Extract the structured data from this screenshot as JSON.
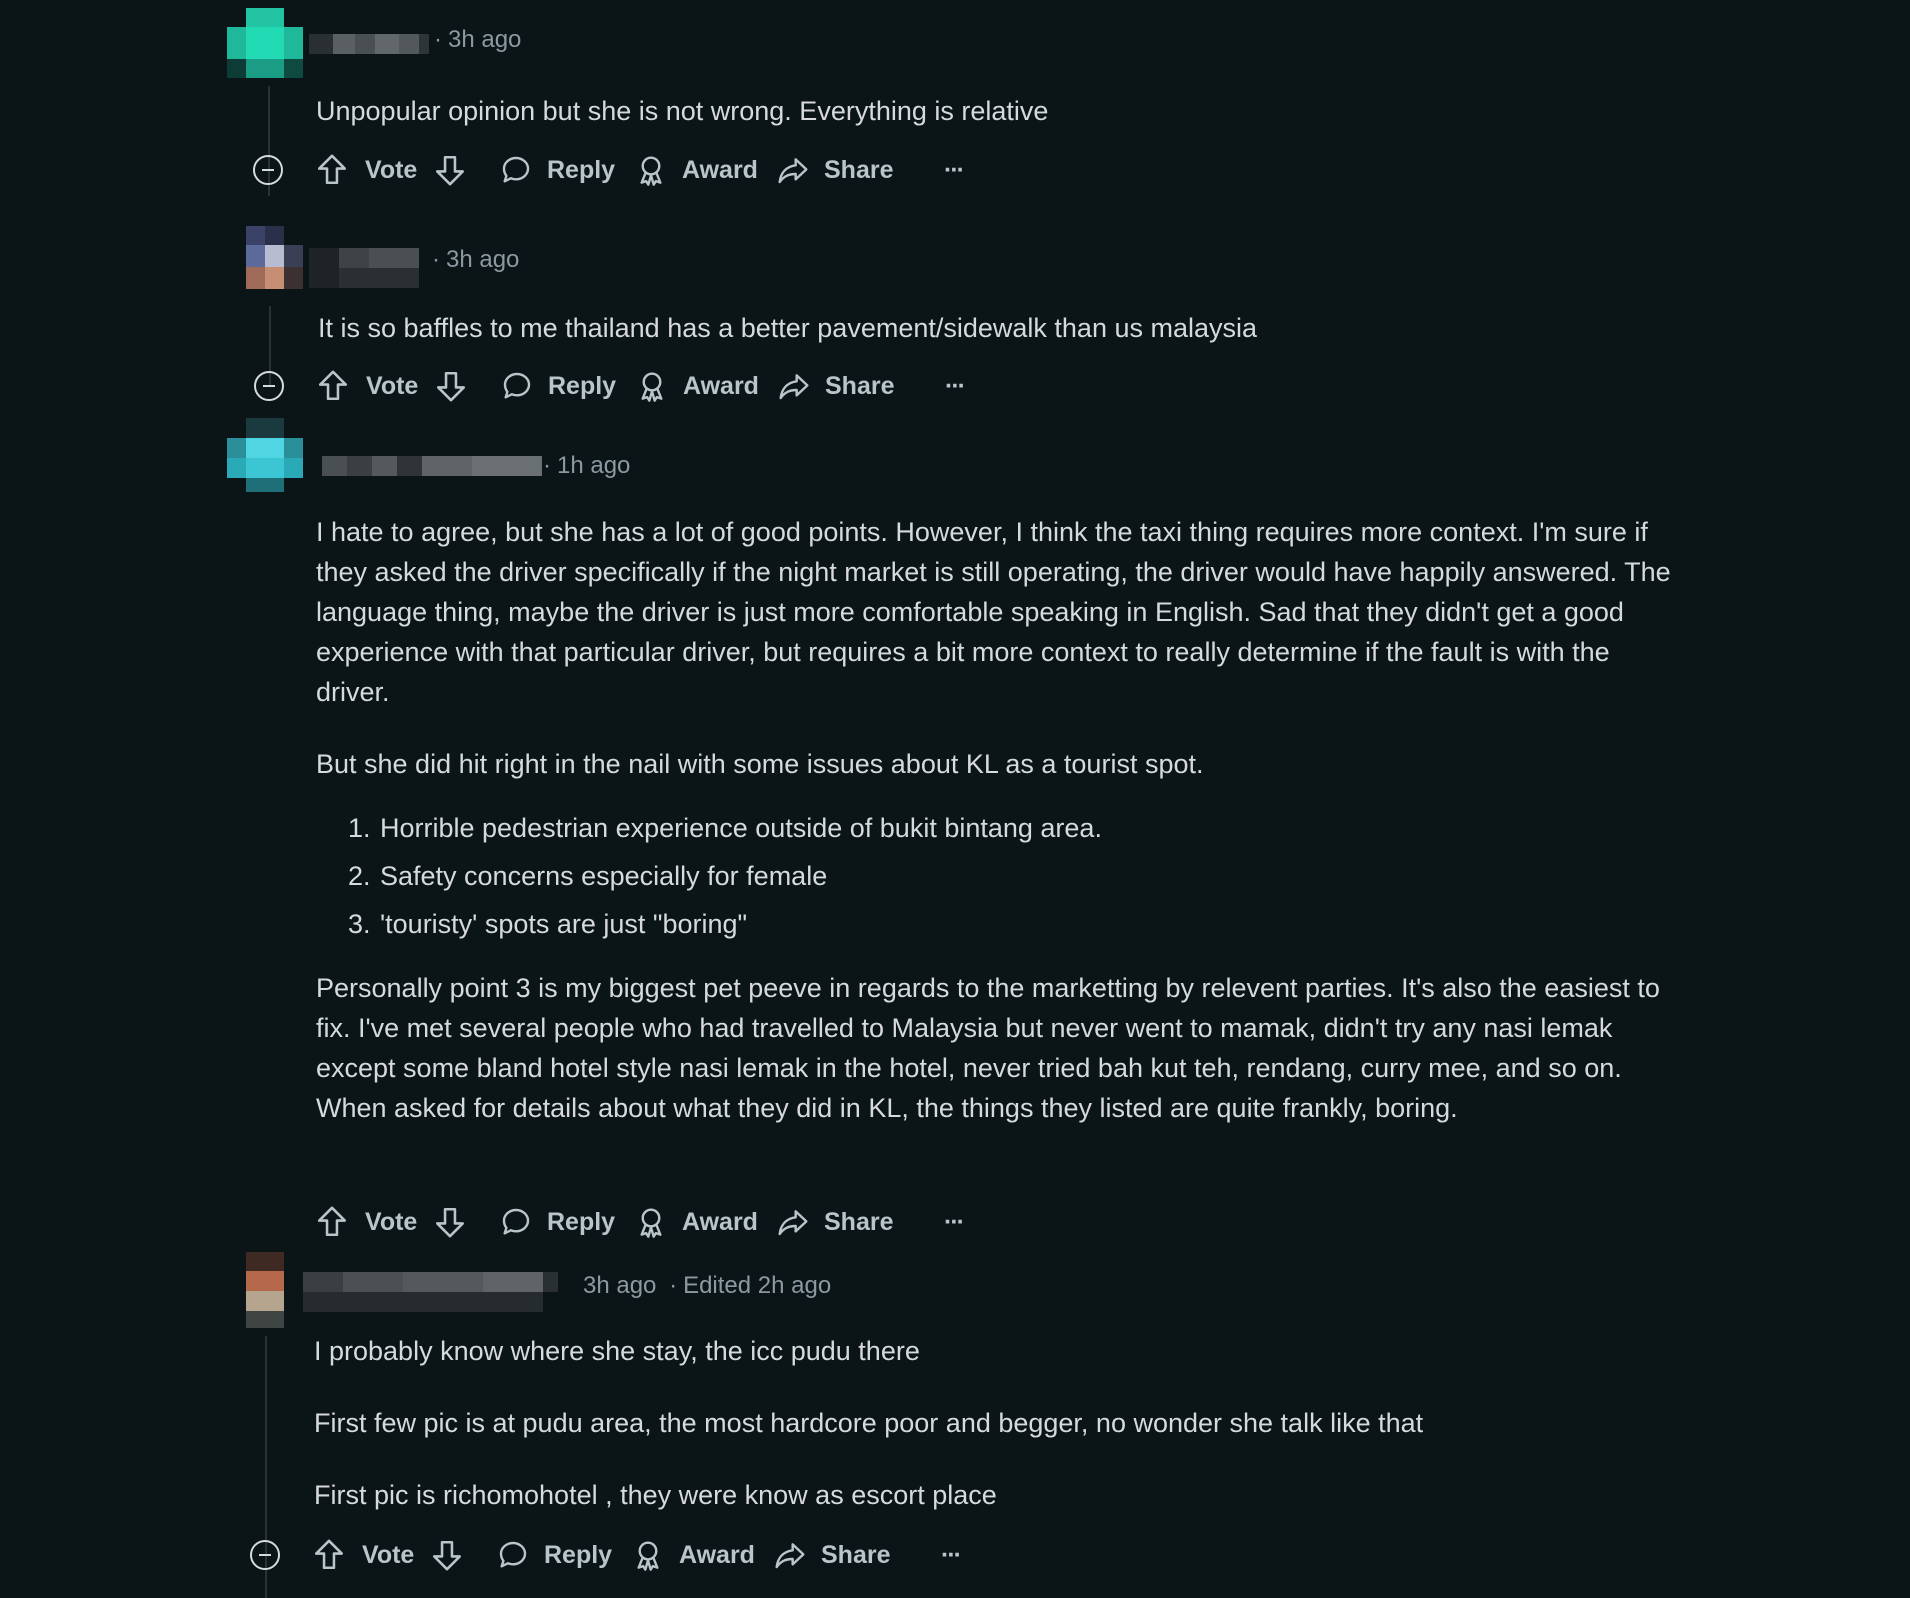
{
  "actions": {
    "vote_label": "Vote",
    "reply_label": "Reply",
    "award_label": "Award",
    "share_label": "Share",
    "more_label": "···"
  },
  "comments": [
    {
      "time": "3h ago",
      "paragraphs": [
        "Unpopular opinion but she is not wrong. Everything is relative"
      ]
    },
    {
      "time": "3h ago",
      "paragraphs": [
        "It is so baffles to me thailand has a better pavement/sidewalk than us malaysia"
      ]
    },
    {
      "time": "1h ago",
      "paragraphs": [
        "I hate to agree, but she has a lot of good points. However, I think the taxi thing requires more context. I'm sure if they asked the driver specifically if the night market is still operating, the driver would have happily answered. The language thing, maybe the driver is just more comfortable speaking in English. Sad that they didn't get a good experience with that particular driver, but requires a bit more context to really determine if the fault is with the driver.",
        "But she did hit right in the nail with some issues about KL as a tourist spot.",
        "Personally point 3 is my biggest pet peeve in regards to the marketting by relevent parties. It's also the easiest to fix. I've met several people who had travelled to Malaysia but never went to mamak, didn't try any nasi lemak except some bland hotel style nasi lemak in the hotel, never tried bah kut teh, rendang, curry mee, and so on. When asked for details about what they did in KL, the things they listed are quite frankly, boring."
      ],
      "list": [
        {
          "num": "1.",
          "text": "Horrible pedestrian experience outside of bukit bintang area."
        },
        {
          "num": "2.",
          "text": "Safety concerns especially for female"
        },
        {
          "num": "3.",
          "text": "'touristy' spots are just \"boring\""
        }
      ]
    },
    {
      "time": "3h ago",
      "edited": "Edited 2h ago",
      "paragraphs": [
        "I probably know where she stay, the icc pudu there",
        "First few pic is at pudu area, the most hardcore poor and begger, no wonder she talk like that",
        "First pic is richomohotel , they were know as escort place"
      ]
    }
  ],
  "colors": {
    "background": "#0b1416",
    "text": "#d7dadc",
    "meta": "#8b9aa2",
    "action": "#b8c5c9",
    "avatar1": "#1fd1a8",
    "avatar3": "#3fc4d2"
  },
  "icons": [
    "upvote-icon",
    "downvote-icon",
    "reply-icon",
    "award-icon",
    "share-icon",
    "more-icon",
    "collapse-icon",
    "avatar"
  ]
}
